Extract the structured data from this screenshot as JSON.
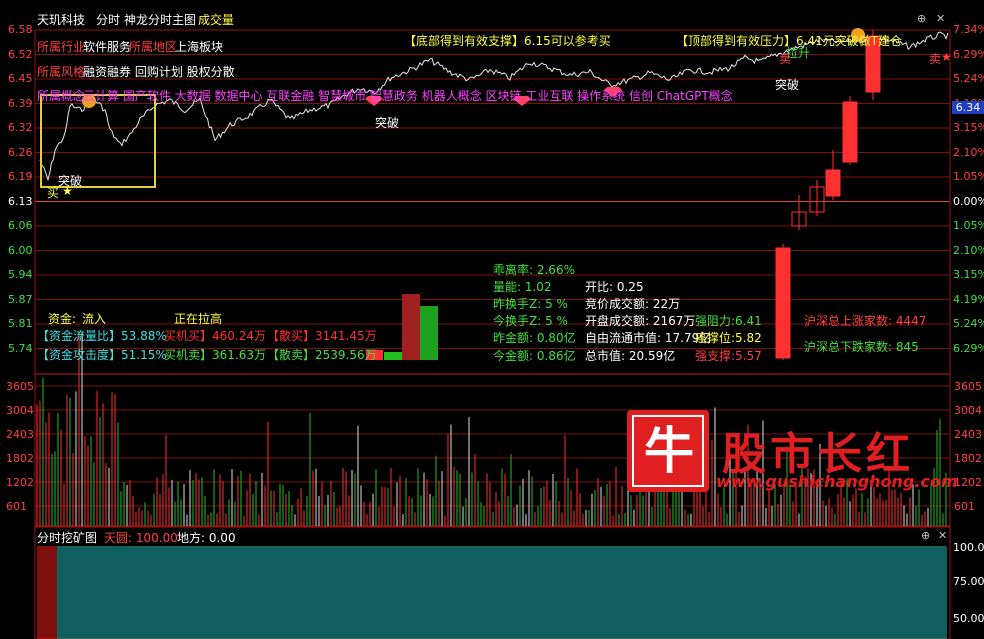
{
  "header": {
    "stock_name": "天玑科技",
    "mode": "分时",
    "indicator": "神龙分时主图",
    "volume_tab": "成交量"
  },
  "price_axis": [
    "6.58",
    "6.52",
    "6.45",
    "6.39",
    "6.32",
    "6.26",
    "6.19",
    "6.13",
    "6.06",
    "6.00",
    "5.94",
    "5.87",
    "5.81",
    "5.74"
  ],
  "pct_axis": [
    "7.34%",
    "6.29%",
    "5.24%",
    "4.19%",
    "3.15%",
    "2.10%",
    "1.05%",
    "0.00%",
    "1.05%",
    "2.10%",
    "3.15%",
    "4.19%",
    "5.24%",
    "6.29%"
  ],
  "current_price_tag": "6.34",
  "info": {
    "industry_label": "所属行业",
    "industry_value": "软件服务",
    "region_label": "所属地区",
    "region_value": "上海板块",
    "style_label": "所属风格",
    "style_value": "融资融券 回购计划 股权分散",
    "concept_label": "所属概念",
    "concept_value": "云计算 国产软件 大数据 数据中心 互联金融 智慧城市 智慧政务 机器人概念 区块链 工业互联 操作系统 信创 ChatGPT概念"
  },
  "banners": {
    "support": "【底部得到有效支撑】6.15可以参考买",
    "resistance": "【顶部得到有效压力】6.41元突破做T建仓"
  },
  "marks": {
    "breakout": "突破",
    "buy": "买",
    "sell": "卖",
    "pull": "拉升"
  },
  "fund": {
    "title": "资金:",
    "flow": "流入",
    "status": "正在拉高",
    "row1_label": "【资金流量比】53.88%",
    "row1_buy": "买机买】460.24万",
    "row1_sell": "【散买】3141.45万",
    "row2_label": "【资金攻击度】51.15%",
    "row2_buy": "买机卖】361.63万",
    "row2_sell": "【散卖】2539.56万"
  },
  "stats": {
    "deviation": "乖离率: 2.66%",
    "volume_ratio": "量能: 1.02",
    "open_ratio": "开比: 0.25",
    "yest_turnover": "昨换手Z: 5 %",
    "auction_volume": "竞价成交额: 22万",
    "today_turnover": "今换手Z: 5 %",
    "open_volume": "开盘成交额: 2167万",
    "strong_resistance": "强阻力:6.41",
    "yest_amount": "昨金额: 0.80亿",
    "float_cap": "自由流通市值: 17.79亿",
    "support_level": "癌撑位:5.82",
    "today_amount": "今金额: 0.86亿",
    "total_cap": "总市值: 20.59亿",
    "strong_support": "强支撑:5.57",
    "market_up": "沪深总上涨家数: 4447",
    "market_down": "沪深总下跌家数: 845"
  },
  "volume_axis": [
    "3605",
    "3004",
    "2403",
    "1802",
    "1202",
    "601"
  ],
  "watermark": {
    "logo_char": "牛",
    "title": "股市长红",
    "url": "www.gushichanghong.com"
  },
  "sub_panel": {
    "title": "分时挖矿图",
    "sky": "天圆: 100.00",
    "earth": "地方: 0.00",
    "axis": [
      "100.00",
      "75.00",
      "50.00"
    ]
  },
  "colors": {
    "up": "#ff3030",
    "down": "#00c000",
    "grid": "#a01010",
    "yellow": "#ffff40",
    "magenta": "#ff40ff",
    "cyan": "#40e0e0"
  }
}
